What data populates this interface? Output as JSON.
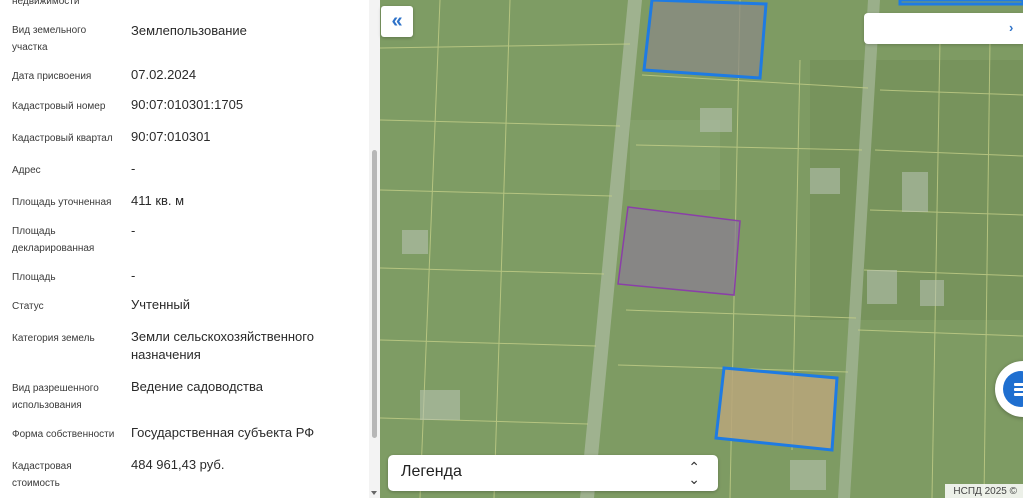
{
  "info_panel": {
    "fields": [
      {
        "label": "недвижимости",
        "value": ""
      },
      {
        "label": "Вид земельного участка",
        "value": "Землепользование"
      },
      {
        "label": "Дата присвоения",
        "value": "07.02.2024"
      },
      {
        "label": "Кадастровый номер",
        "value": "90:07:010301:1705"
      },
      {
        "label": "Кадастровый квартал",
        "value": "90:07:010301"
      },
      {
        "label": "Адрес",
        "value": "-"
      },
      {
        "label": "Площадь уточненная",
        "value": "411 кв. м"
      },
      {
        "label": "Площадь декларированная",
        "value": "-"
      },
      {
        "label": "Площадь",
        "value": "-"
      },
      {
        "label": "Статус",
        "value": "Учтенный"
      },
      {
        "label": "Категория земель",
        "value": "Земли сельскохозяйственного назначения"
      },
      {
        "label": "Вид разрешенного использования",
        "value": "Ведение садоводства"
      },
      {
        "label": "Форма собственности",
        "value": "Государственная субъекта РФ"
      },
      {
        "label": "Кадастровая стоимость",
        "value": "484 961,43 руб."
      }
    ]
  },
  "map": {
    "collapse_icon": "double-chevron-left-icon",
    "collapse_glyph": "«",
    "legend_label": "Легенда",
    "legend_icon": "chevron-up-down-icon",
    "chat_icon": "chat-icon",
    "copyright": "НСПД 2025 ©",
    "colors": {
      "selected_parcel": "#8a3fa8",
      "highlighted_parcel": "#1e7be3",
      "parcel_lines": "#c8d28a",
      "accent": "#2f73c9"
    }
  }
}
